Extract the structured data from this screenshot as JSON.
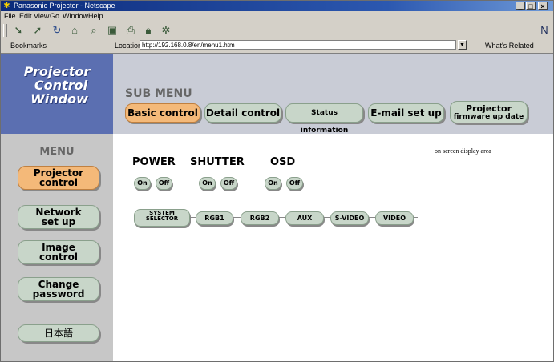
{
  "window": {
    "title": "Panasonic Projector - Netscape",
    "min": "_",
    "max": "□",
    "close": "×"
  },
  "menubar": [
    "File",
    "Edit",
    "View",
    "Go",
    "Window",
    "Help"
  ],
  "toolbar_icons": [
    "back-icon",
    "forward-icon",
    "reload-icon",
    "home-icon",
    "search-icon",
    "netscape-icon",
    "print-icon",
    "security-icon",
    "stop-icon"
  ],
  "location": {
    "bookmarks": "Bookmarks",
    "label": "Location:",
    "url": "http://192.168.0.8/en/menu1.htm",
    "related": "What's Related"
  },
  "header": {
    "logo_lines": [
      "Projector",
      "Control",
      "Window"
    ]
  },
  "submenu": {
    "title": "SUB MENU",
    "items": [
      {
        "label": "Basic control",
        "active": true
      },
      {
        "label": "Detail control",
        "active": false
      },
      {
        "label": "Status information",
        "active": false
      },
      {
        "label": "E-mail set up",
        "active": false
      },
      {
        "label_line1": "Projector",
        "label_line2": "firmware up date",
        "active": false
      }
    ]
  },
  "menu": {
    "title": "MENU",
    "items": [
      {
        "line1": "Projector",
        "line2": "control",
        "active": true
      },
      {
        "line1": "Network",
        "line2": "set up",
        "active": false
      },
      {
        "line1": "Image",
        "line2": "control",
        "active": false
      },
      {
        "line1": "Change",
        "line2": "password",
        "active": false
      },
      {
        "line1": "日本語",
        "line2": "",
        "active": false
      }
    ]
  },
  "controls": {
    "osd_note": "on screen display area",
    "power": {
      "label": "POWER",
      "on": "On",
      "off": "Off"
    },
    "shutter": {
      "label": "SHUTTER",
      "on": "On",
      "off": "Off"
    },
    "osd": {
      "label": "OSD",
      "on": "On",
      "off": "Off"
    }
  },
  "sources": {
    "selector_line1": "SYSTEM",
    "selector_line2": "SELECTOR",
    "items": [
      "RGB1",
      "RGB2",
      "AUX",
      "S-VIDEO",
      "VIDEO"
    ]
  },
  "colors": {
    "active": "#f4b979",
    "button": "#c8d6c9",
    "logo_bg": "#5b6fb1"
  }
}
